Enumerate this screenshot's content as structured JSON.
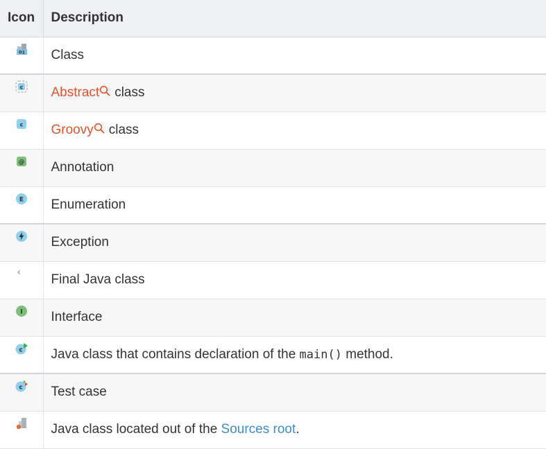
{
  "header": {
    "icon_col": "Icon",
    "description_col": "Description"
  },
  "rows": [
    {
      "icon": "class-icon",
      "text": "Class"
    },
    {
      "icon": "abstract-class-icon",
      "link": "Abstract",
      "rest": "class"
    },
    {
      "icon": "groovy-class-icon",
      "link": "Groovy",
      "rest": "class"
    },
    {
      "icon": "annotation-icon",
      "text": "Annotation"
    },
    {
      "icon": "enumeration-icon",
      "text": "Enumeration"
    },
    {
      "icon": "exception-icon",
      "text": "Exception"
    },
    {
      "icon": "final-java-class-icon",
      "text": "Final Java class"
    },
    {
      "icon": "interface-icon",
      "text": "Interface"
    },
    {
      "icon": "main-class-icon",
      "before": "Java class that contains declaration of the",
      "code": "main()",
      "after": "method."
    },
    {
      "icon": "test-case-icon",
      "text": "Test case"
    },
    {
      "icon": "out-of-sources-class-icon",
      "before": "Java class located out of the",
      "link": "Sources root",
      "after": "."
    }
  ],
  "colors": {
    "link_red": "#e4532c",
    "link_blue": "#3c8dc4",
    "header_bg": "#eef0f3"
  }
}
